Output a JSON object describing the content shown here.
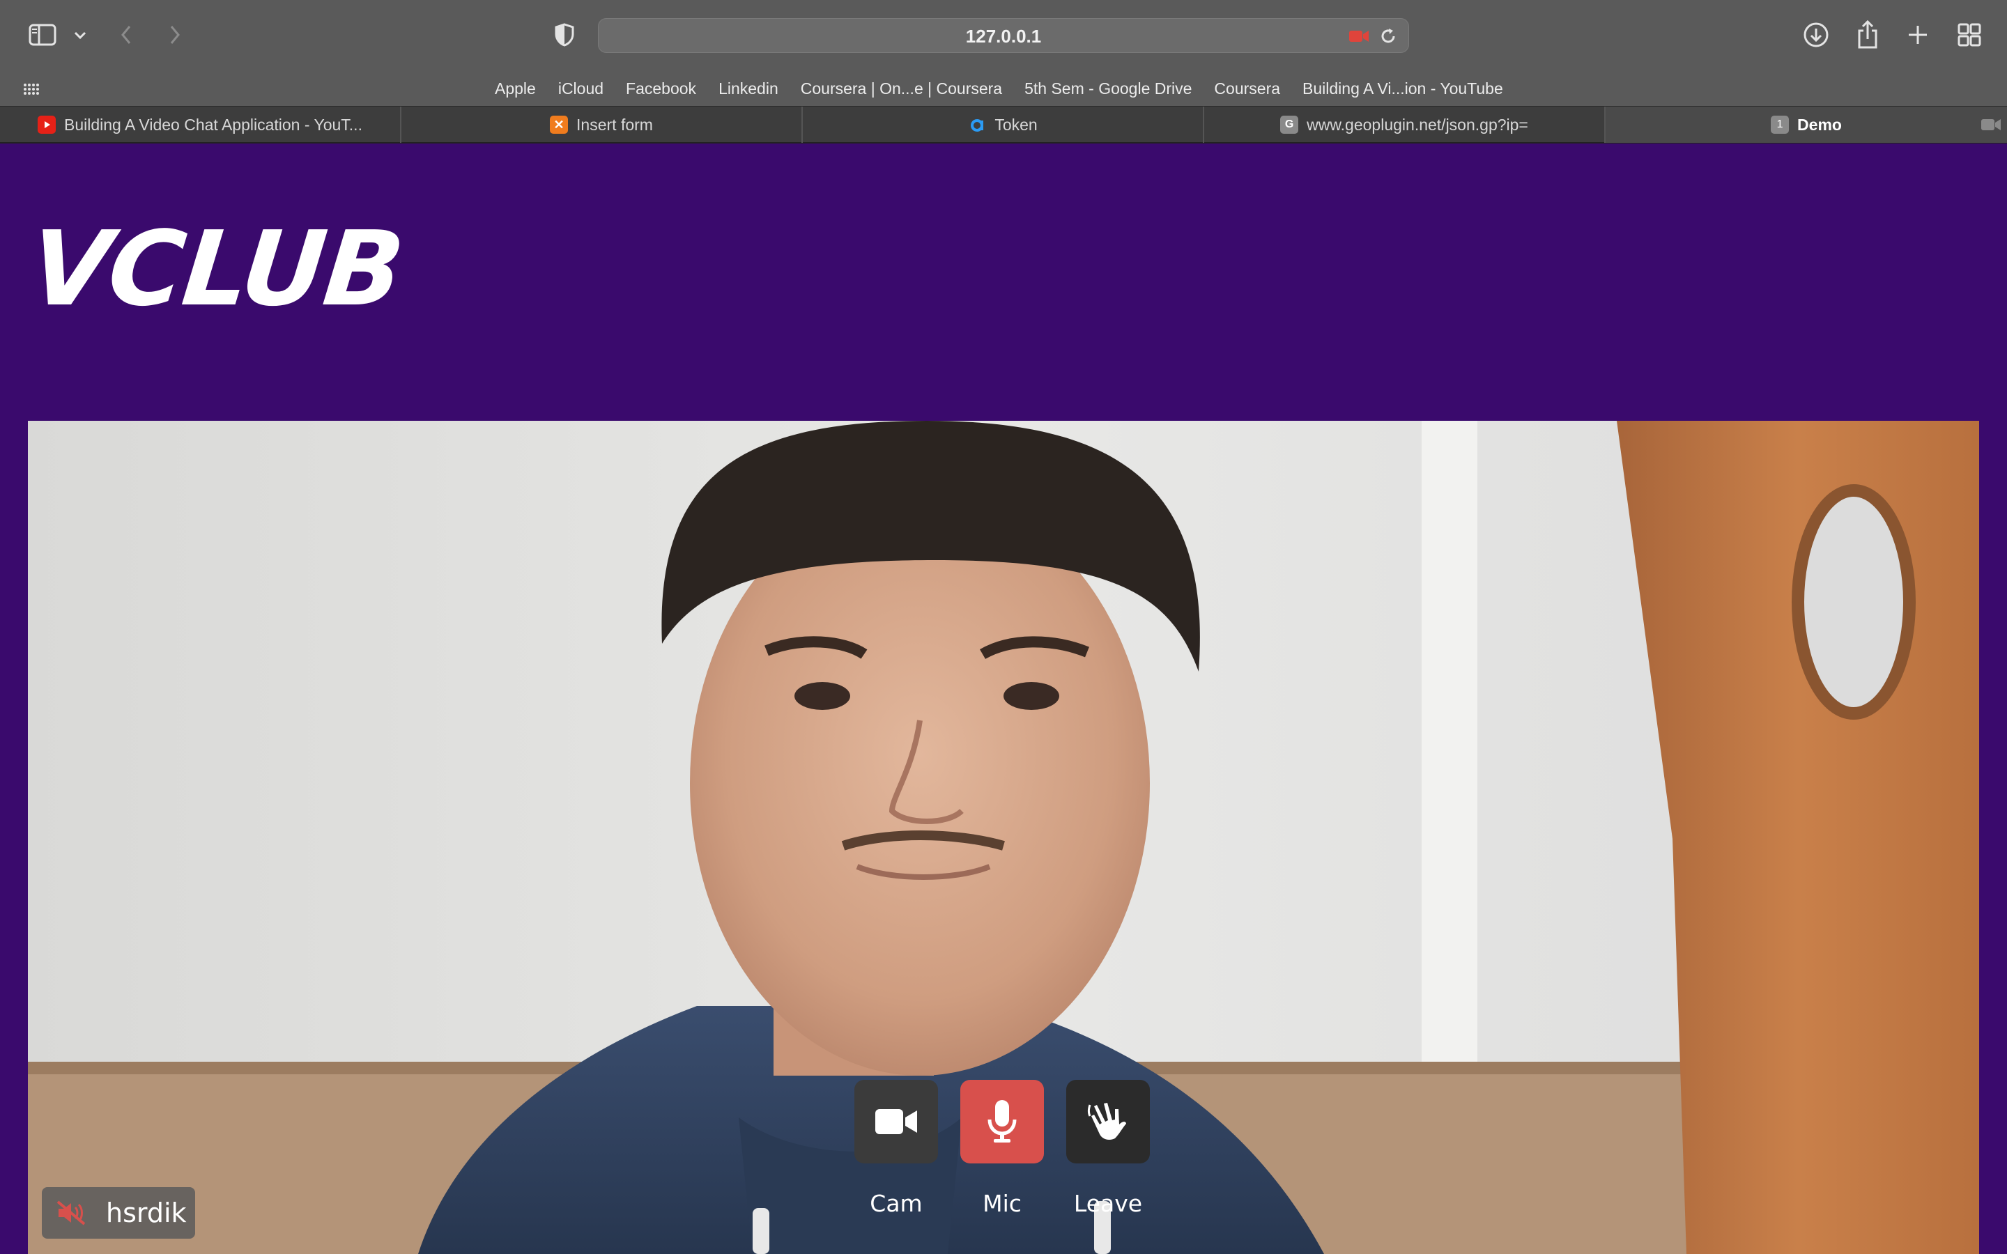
{
  "browser": {
    "url": "127.0.0.1",
    "favorites": [
      "Apple",
      "iCloud",
      "Facebook",
      "Linkedin",
      "Coursera | On...e | Coursera",
      "5th Sem - Google Drive",
      "Coursera",
      "Building A Vi...ion - YouTube"
    ],
    "tabs": [
      {
        "title": "Building A Video Chat Application - YouT...",
        "icon": "youtube-icon",
        "active": false
      },
      {
        "title": "Insert form",
        "icon": "xampp-icon",
        "active": false
      },
      {
        "title": "Token",
        "icon": "agora-icon",
        "active": false
      },
      {
        "title": "www.geoplugin.net/json.gp?ip=",
        "icon": "letter-g-icon",
        "favicon_letter": "G",
        "active": false
      },
      {
        "title": "Demo",
        "icon": "number-badge",
        "favicon_letter": "1",
        "active": true
      }
    ]
  },
  "app": {
    "logo": "VCLUB",
    "controls": [
      {
        "label": "Cam",
        "icon": "video-camera-icon",
        "color": "#3b3b3b"
      },
      {
        "label": "Mic",
        "icon": "microphone-icon",
        "color": "#d8504c"
      },
      {
        "label": "Leave",
        "icon": "waving-hand-icon",
        "color": "#2b2b2b"
      }
    ],
    "participant": {
      "name": "hsrdik",
      "icon": "muted-speaker-icon"
    }
  },
  "colors": {
    "page_bg": "#3a0a6d",
    "mic_active": "#d8504c",
    "recording": "#e0443b"
  }
}
